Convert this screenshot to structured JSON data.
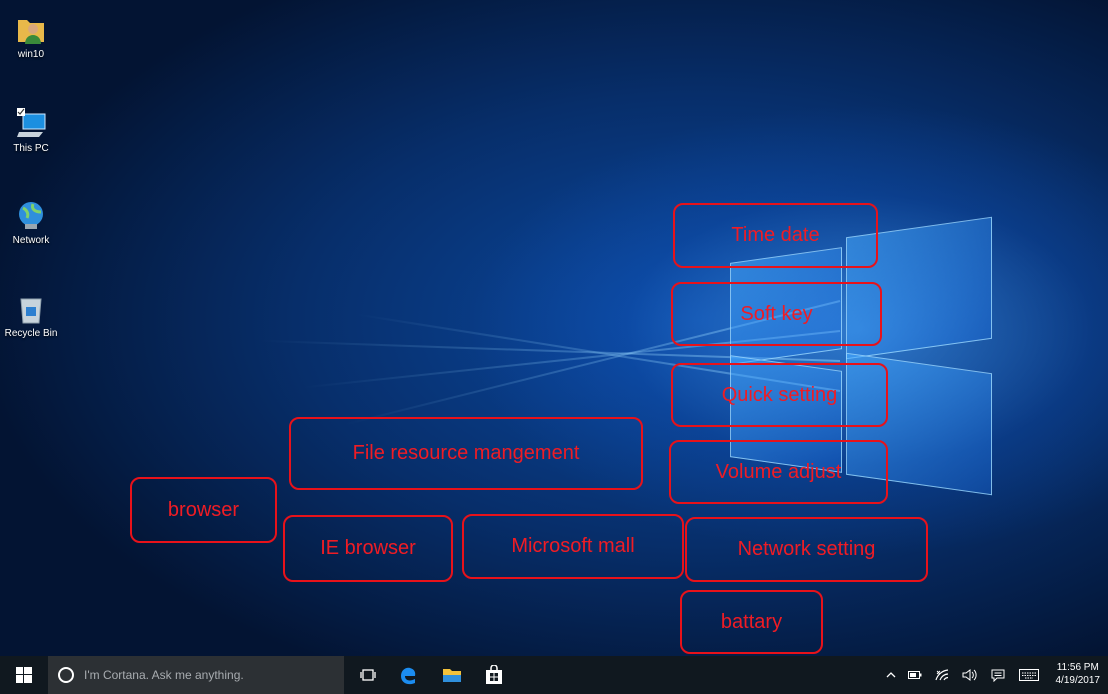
{
  "desktop_icons": [
    {
      "label": "win10",
      "icon": "user-folder-icon"
    },
    {
      "label": "This PC",
      "icon": "computer-icon"
    },
    {
      "label": "Network",
      "icon": "network-icon"
    },
    {
      "label": "Recycle Bin",
      "icon": "recycle-bin-icon"
    }
  ],
  "annotations": {
    "time_date": "Time date",
    "soft_key": "Soft key",
    "quick_setting": "Quick setting",
    "volume_adjust": "Volume adjust",
    "network_setting": "Network setting",
    "battary": "battary",
    "file_resource": "File resource mangement",
    "browser": "browser",
    "ie_browser": "IE browser",
    "microsoft_mall": "Microsoft mall"
  },
  "taskbar": {
    "search_placeholder": "I'm Cortana. Ask me anything.",
    "apps": [
      "task-view-icon",
      "edge-icon",
      "file-explorer-icon",
      "store-icon"
    ],
    "tray_icons": [
      "chevron-up-icon",
      "battery-icon",
      "wifi-icon",
      "volume-icon",
      "action-center-icon",
      "keyboard-icon"
    ],
    "time": "11:56 PM",
    "date": "4/19/2017"
  },
  "colors": {
    "annotation": "#e8121a",
    "taskbar": "#10181f",
    "search_box": "#2c3034"
  }
}
